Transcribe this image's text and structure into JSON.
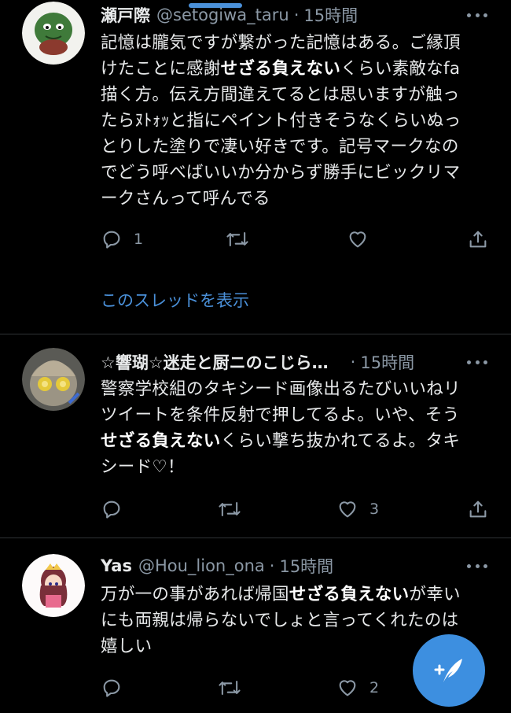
{
  "tweets": [
    {
      "name": "瀬戸際",
      "handle": "@setogiwa_taru",
      "time": "15時間",
      "lines": [
        [
          {
            "t": "記憶は朧気ですが繋がった記憶はある。ご縁頂"
          }
        ],
        [
          {
            "t": "けたことに感謝"
          },
          {
            "t": "せざる負えない",
            "b": true
          },
          {
            "t": "くらい素敵なfa"
          }
        ],
        [
          {
            "t": "描く方。伝え方間違えてるとは思いますが触っ"
          }
        ],
        [
          {
            "t": "たらﾇﾄｫｯと指にペイント付きそうなくらいぬっ"
          }
        ],
        [
          {
            "t": "とりした塗りで凄い好きです。記号マークなの"
          }
        ],
        [
          {
            "t": "でどう呼べばいいか分からず勝手にビックリマ"
          }
        ],
        [
          {
            "t": "ークさんって呼んでる"
          }
        ]
      ],
      "reply_count": "1",
      "retweet_count": "",
      "like_count": ""
    },
    {
      "name": "☆響瑚☆迷走と厨ニのこじら…",
      "handle": "",
      "time": "15時間",
      "lines": [
        [
          {
            "t": "警察学校組のタキシード画像出るたびいいねリ"
          }
        ],
        [
          {
            "t": "ツイートを条件反射で押してるよ。いや、そう"
          }
        ],
        [
          {
            "t": "せざる負えない",
            "b": true
          },
          {
            "t": "くらい撃ち抜かれてるよ。タキ"
          }
        ],
        [
          {
            "t": "シード♡！"
          }
        ]
      ],
      "reply_count": "",
      "retweet_count": "",
      "like_count": "3"
    },
    {
      "name": "Yas",
      "handle": "@Hou_lion_ona",
      "time": "15時間",
      "lines": [
        [
          {
            "t": "万が一の事があれば帰国"
          },
          {
            "t": "せざる負えない",
            "b": true
          },
          {
            "t": "が幸い"
          }
        ],
        [
          {
            "t": "にも両親は帰らないでしょと言ってくれたのは"
          }
        ],
        [
          {
            "t": "嬉しい"
          }
        ]
      ],
      "reply_count": "",
      "retweet_count": "",
      "like_count": "2"
    }
  ],
  "thread_link": "このスレッドを表示",
  "dot": "·",
  "colors": {
    "background": "#000000",
    "text": "#e7e9ea",
    "secondary": "#8b98a5",
    "accent": "#4a90d9",
    "fab": "#3d8fe0"
  },
  "icons": {
    "reply": "reply-icon",
    "retweet": "retweet-icon",
    "like": "heart-icon",
    "share": "share-icon",
    "more": "more-icon",
    "compose": "compose-tweet-icon"
  }
}
